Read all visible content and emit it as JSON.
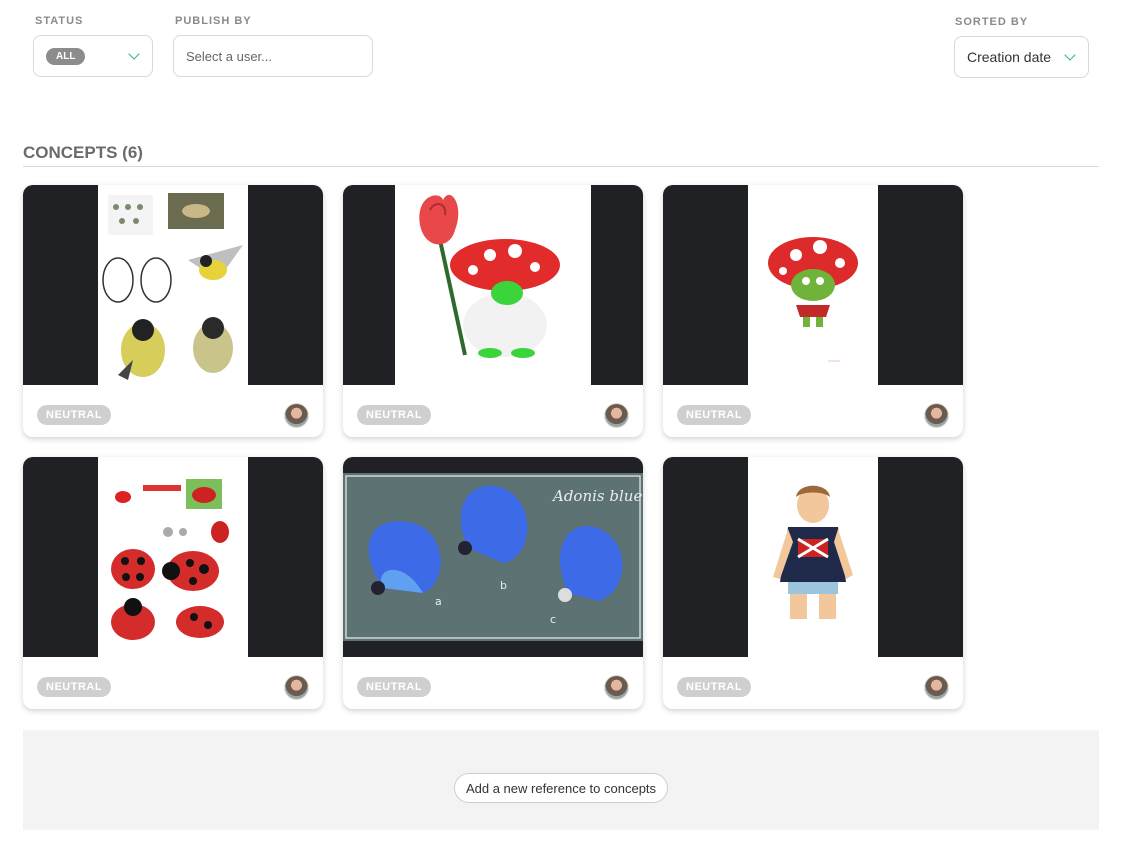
{
  "filters": {
    "status_label": "STATUS",
    "status_value": "ALL",
    "publish_label": "PUBLISH BY",
    "publish_placeholder": "Select a user...",
    "sorted_label": "SORTED BY",
    "sorted_value": "Creation date"
  },
  "section": {
    "title": "CONCEPTS (6)"
  },
  "cards": [
    {
      "status": "NEUTRAL",
      "image": "bird-sketches"
    },
    {
      "status": "NEUTRAL",
      "image": "mushroom-rose-character"
    },
    {
      "status": "NEUTRAL",
      "image": "mushroom-goblin"
    },
    {
      "status": "NEUTRAL",
      "image": "ladybug-sketches"
    },
    {
      "status": "NEUTRAL",
      "image": "butterflies",
      "text": "Adonis blue"
    },
    {
      "status": "NEUTRAL",
      "image": "boy-union-jack"
    }
  ],
  "colors": {
    "accent": "#2bb673",
    "thumb_bg": "#202124",
    "pill": "#cfcfcf"
  },
  "add_button": "Add a new reference to concepts"
}
